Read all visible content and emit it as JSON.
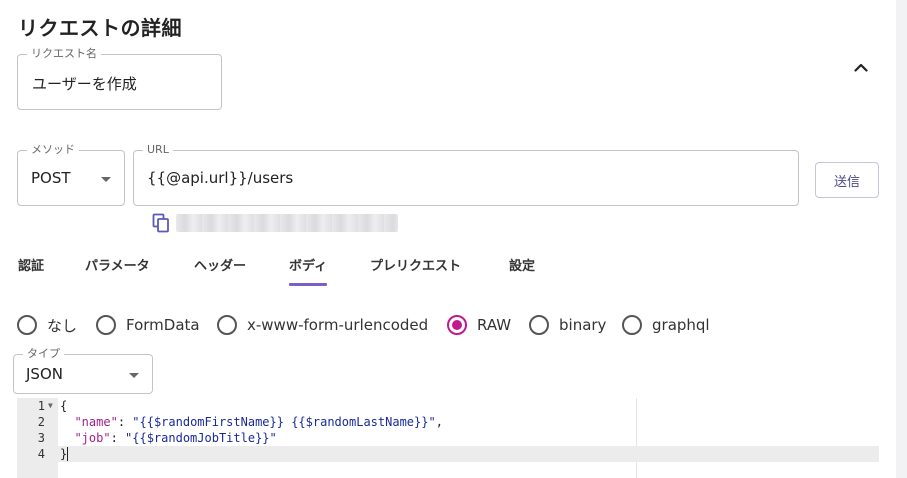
{
  "page": {
    "title": "リクエストの詳細"
  },
  "request_name": {
    "label": "リクエスト名",
    "value": "ユーザーを作成"
  },
  "method": {
    "label": "メソッド",
    "value": "POST"
  },
  "url": {
    "label": "URL",
    "value": "{{@api.url}}/users"
  },
  "send_button": {
    "label": "送信"
  },
  "tabs": [
    {
      "label": "認証"
    },
    {
      "label": "パラメータ"
    },
    {
      "label": "ヘッダー"
    },
    {
      "label": "ボディ",
      "active": true
    },
    {
      "label": "プレリクエスト"
    },
    {
      "label": "設定"
    }
  ],
  "body_types": [
    {
      "label": "なし",
      "checked": false
    },
    {
      "label": "FormData",
      "checked": false
    },
    {
      "label": "x-www-form-urlencoded",
      "checked": false
    },
    {
      "label": "RAW",
      "checked": true
    },
    {
      "label": "binary",
      "checked": false
    },
    {
      "label": "graphql",
      "checked": false
    }
  ],
  "type_select": {
    "label": "タイプ",
    "value": "JSON"
  },
  "editor": {
    "lines": [
      {
        "num": "1",
        "open": "{"
      },
      {
        "num": "2",
        "key": "\"name\"",
        "sep": ": ",
        "value": "\"{{$randomFirstName}} {{$randomLastName}}\"",
        "end": ","
      },
      {
        "num": "3",
        "key": "\"job\"",
        "sep": ": ",
        "value": "\"{{$randomJobTitle}}\"",
        "end": ""
      },
      {
        "num": "4",
        "close": "}"
      }
    ]
  },
  "colors": {
    "accent": "#7c5fc6",
    "radio_checked": "#c2188d",
    "button_text": "#4a4a8a"
  },
  "icons": {
    "collapse": "chevron-up-icon",
    "copy": "copy-icon",
    "dropdown": "caret-down-icon",
    "fold": "fold-arrow-icon"
  }
}
